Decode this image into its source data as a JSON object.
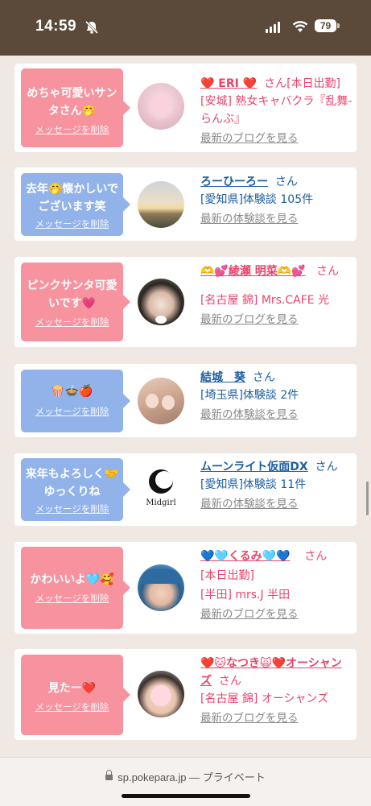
{
  "status": {
    "time": "14:59",
    "battery": "79"
  },
  "browser": {
    "domain": "sp.pokepara.jp",
    "mode": "— プライベート"
  },
  "cards": [
    {
      "bubble": "めちゃ可愛いサンタさん🤭",
      "delete": "メッセージを削除",
      "name": "❤️ ERI ❤️",
      "san": "さん",
      "lines": [
        "[本日出勤]",
        "[安城] 熟女キャバクラ『乱舞-らんぶ』"
      ],
      "more": "最新のブログを見る"
    },
    {
      "bubble": "去年🤭懐かしいでございます笑",
      "delete": "メッセージを削除",
      "name": "ろーひーろー",
      "san": "さん",
      "lines": [
        "[愛知県]体験談 105件"
      ],
      "more": "最新の体験談を見る"
    },
    {
      "bubble": "ピンクサンタ可愛いです💗",
      "delete": "メッセージを削除",
      "name": "🫶💕綾瀬 明菜🫶💕",
      "san": "さん",
      "lines": [
        "[名古屋 錦] Mrs.CAFE 光"
      ],
      "more": "最新のブログを見る"
    },
    {
      "bubble": "🍿🍲🍎",
      "delete": "メッセージを削除",
      "name": "結城　葵",
      "san": "さん",
      "lines": [
        "[埼玉県]体験談 2件"
      ],
      "more": "最新の体験談を見る"
    },
    {
      "bubble": "来年もよろしく🤝ゆっくりね",
      "delete": "メッセージを削除",
      "name": "ムーンライト仮面DX",
      "san": "さん",
      "lines": [
        "[愛知県]体験談 11件"
      ],
      "more": "最新の体験談を見る",
      "avatar_text": "Midgirl"
    },
    {
      "bubble": "かわいいよ🩵🥰",
      "delete": "メッセージを削除",
      "name": "💙🩵くるみ🩵💙",
      "san": "さん",
      "lines": [
        "[本日出勤]",
        "[半田] mrs.J 半田"
      ],
      "more": "最新のブログを見る"
    },
    {
      "bubble": "見たー❤️",
      "delete": "メッセージを削除",
      "name": "❤️🐱なつき🙀❤️オーシャンズ",
      "san": "さん",
      "lines": [
        "[名古屋 錦] オーシャンズ"
      ],
      "more": "最新のブログを見る"
    }
  ]
}
